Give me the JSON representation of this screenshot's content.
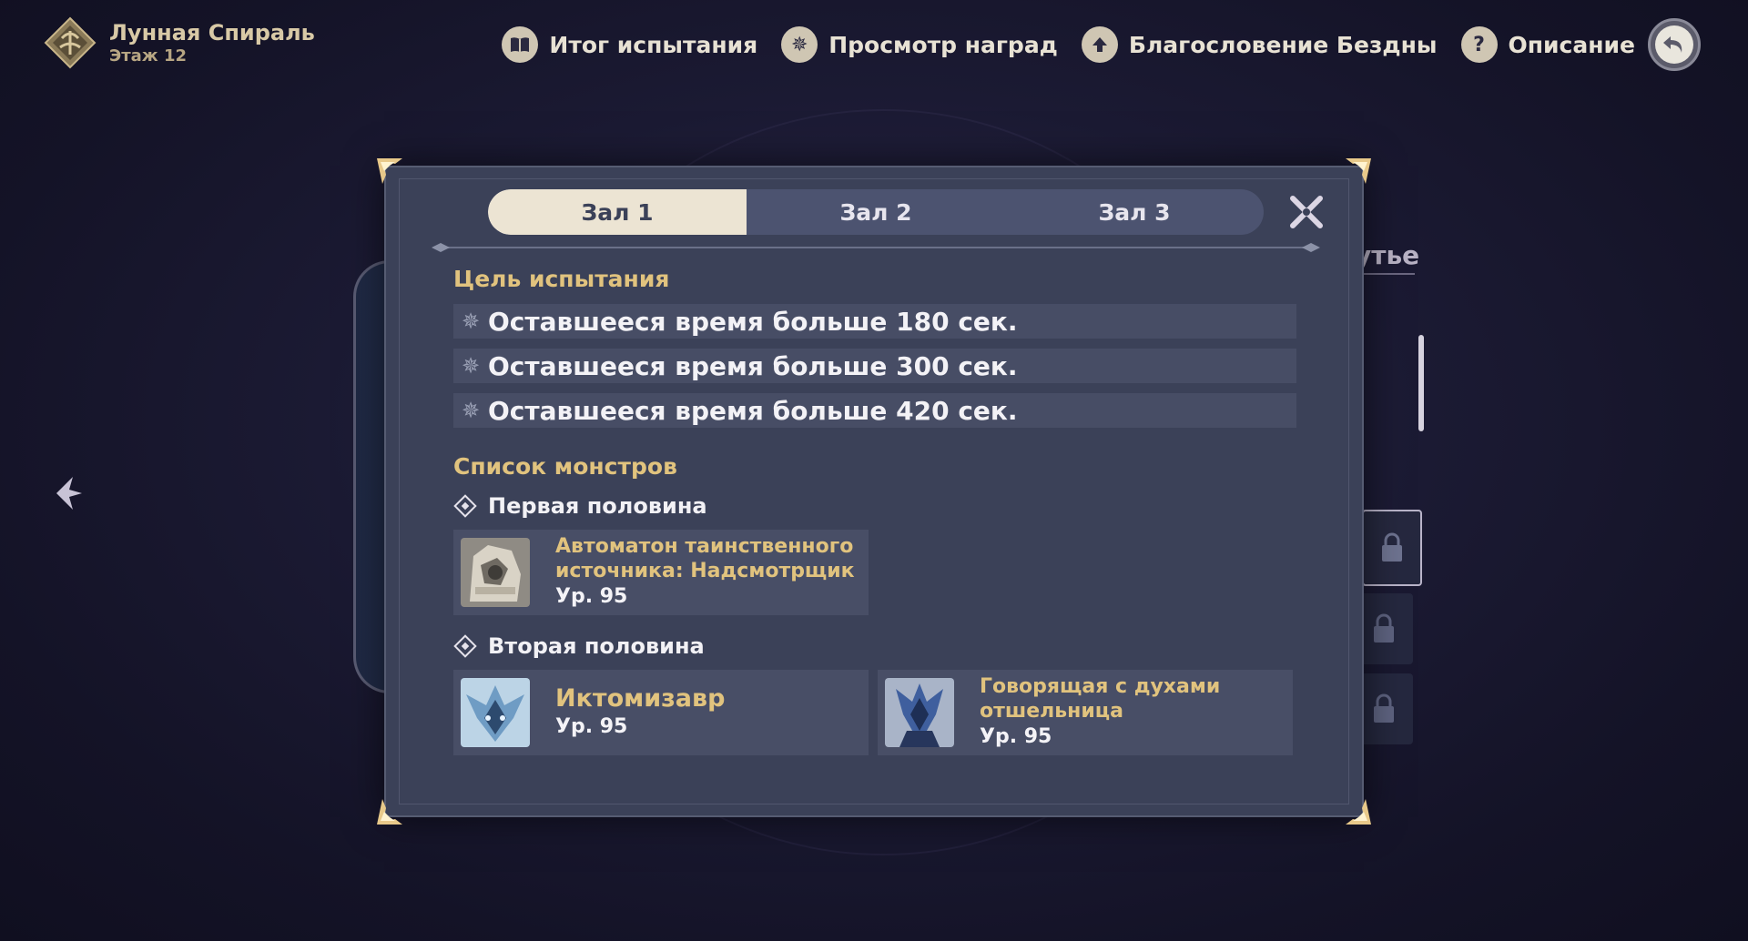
{
  "header": {
    "title": "Лунная Спираль",
    "subtitle": "Этаж 12"
  },
  "nav": [
    {
      "label": "Итог испытания",
      "icon": "book-icon"
    },
    {
      "label": "Просмотр наград",
      "icon": "star-badge-icon"
    },
    {
      "label": "Благословение Бездны",
      "icon": "up-arrow-icon"
    },
    {
      "label": "Описание",
      "icon": "question-icon"
    }
  ],
  "background": {
    "word_fragment": "утье"
  },
  "modal": {
    "tabs": [
      "Зал 1",
      "Зал 2",
      "Зал 3"
    ],
    "active_tab": 0,
    "goal_title": "Цель испытания",
    "goals": [
      "Оставшееся время больше 180 сек.",
      "Оставшееся время больше 300 сек.",
      "Оставшееся время больше 420 сек."
    ],
    "monsters_title": "Список монстров",
    "first_half": {
      "label": "Первая половина",
      "monsters": [
        {
          "name_line1": "Автоматон таинственного",
          "name_line2": "источника: Надсмотрщик",
          "level": "Ур. 95"
        }
      ]
    },
    "second_half": {
      "label": "Вторая половина",
      "monsters": [
        {
          "name_line1": "Иктомизавр",
          "name_line2": "",
          "level": "Ур. 95"
        },
        {
          "name_line1": "Говорящая с духами",
          "name_line2": "отшельница",
          "level": "Ур. 95"
        }
      ]
    }
  },
  "colors": {
    "accent_gold": "#e1c37e",
    "modal_bg": "#3b4158",
    "tab_active_bg": "#ece4d3"
  }
}
